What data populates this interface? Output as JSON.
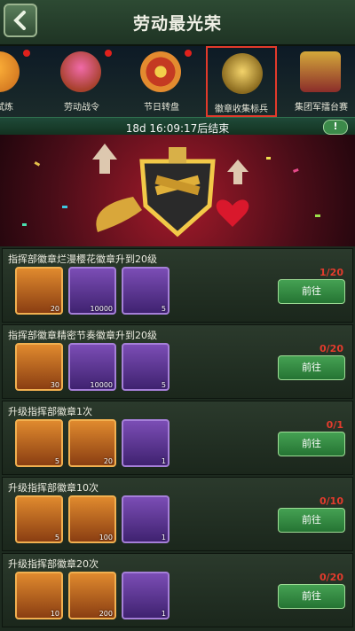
{
  "header": {
    "title": "劳动最光荣"
  },
  "tabs": [
    {
      "label": "荣试炼",
      "badge": true
    },
    {
      "label": "劳动战令",
      "badge": true
    },
    {
      "label": "节日转盘",
      "badge": true
    },
    {
      "label": "徽章收集标兵",
      "badge": false,
      "active": true
    },
    {
      "label": "集团军擂台赛",
      "badge": false
    }
  ],
  "timer": {
    "text": "18d 16:09:17后结束",
    "info": "!"
  },
  "tasks": [
    {
      "title": "指挥部徽章烂漫樱花徽章升到20级",
      "progress": "1/20",
      "button": "前往",
      "items": [
        {
          "type": "badge-chest",
          "count": "20"
        },
        {
          "type": "ore",
          "count": "10000"
        },
        {
          "type": "magnifier",
          "count": "5"
        }
      ]
    },
    {
      "title": "指挥部徽章精密节奏徽章升到20级",
      "progress": "0/20",
      "button": "前往",
      "items": [
        {
          "type": "badge-chest",
          "count": "30"
        },
        {
          "type": "ore",
          "count": "10000"
        },
        {
          "type": "magnifier",
          "count": "5"
        }
      ]
    },
    {
      "title": "升级指挥部徽章1次",
      "progress": "0/1",
      "button": "前往",
      "items": [
        {
          "type": "badge-chest",
          "count": "5"
        },
        {
          "type": "target",
          "count": "20"
        },
        {
          "type": "star-medal",
          "count": "1"
        }
      ]
    },
    {
      "title": "升级指挥部徽章10次",
      "progress": "0/10",
      "button": "前往",
      "items": [
        {
          "type": "badge-chest",
          "count": "5"
        },
        {
          "type": "target",
          "count": "100"
        },
        {
          "type": "star-medal",
          "count": "1"
        }
      ]
    },
    {
      "title": "升级指挥部徽章20次",
      "progress": "0/20",
      "button": "前往",
      "items": [
        {
          "type": "badge-chest",
          "count": "10"
        },
        {
          "type": "target",
          "count": "200"
        },
        {
          "type": "star-medal",
          "count": "1"
        }
      ]
    }
  ]
}
